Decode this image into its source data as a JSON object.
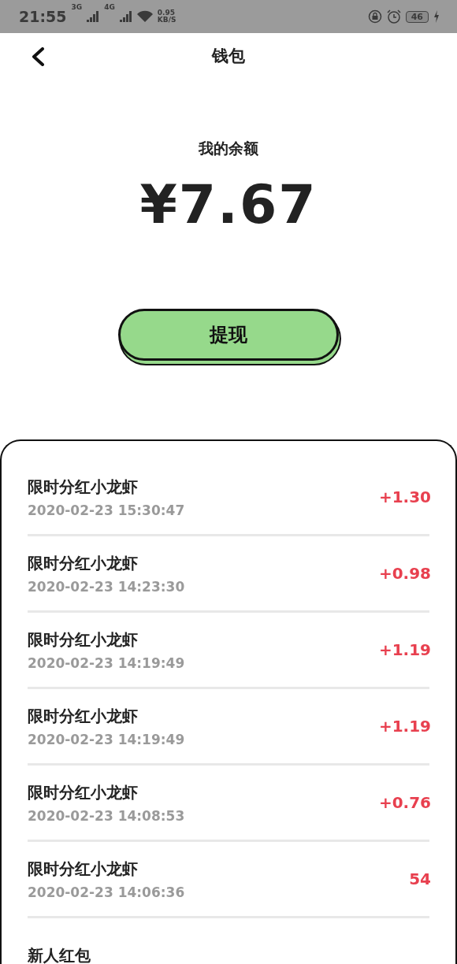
{
  "status_bar": {
    "time": "21:55",
    "net1": "3G",
    "net2": "4G",
    "speed": "0.95",
    "speed_unit": "KB/S",
    "battery": "46"
  },
  "header": {
    "title": "钱包"
  },
  "balance": {
    "label": "我的余额",
    "amount": "¥7.67"
  },
  "withdraw_button": "提现",
  "records": [
    {
      "title": "限时分红小龙虾",
      "time": "2020-02-23 15:30:47",
      "amount": "+1.30"
    },
    {
      "title": "限时分红小龙虾",
      "time": "2020-02-23 14:23:30",
      "amount": "+0.98"
    },
    {
      "title": "限时分红小龙虾",
      "time": "2020-02-23 14:19:49",
      "amount": "+1.19"
    },
    {
      "title": "限时分红小龙虾",
      "time": "2020-02-23 14:19:49",
      "amount": "+1.19"
    },
    {
      "title": "限时分红小龙虾",
      "time": "2020-02-23 14:08:53",
      "amount": "+0.76"
    },
    {
      "title": "限时分红小龙虾",
      "time": "2020-02-23 14:06:36",
      "amount": "54"
    },
    {
      "title": "新人红包"
    }
  ]
}
